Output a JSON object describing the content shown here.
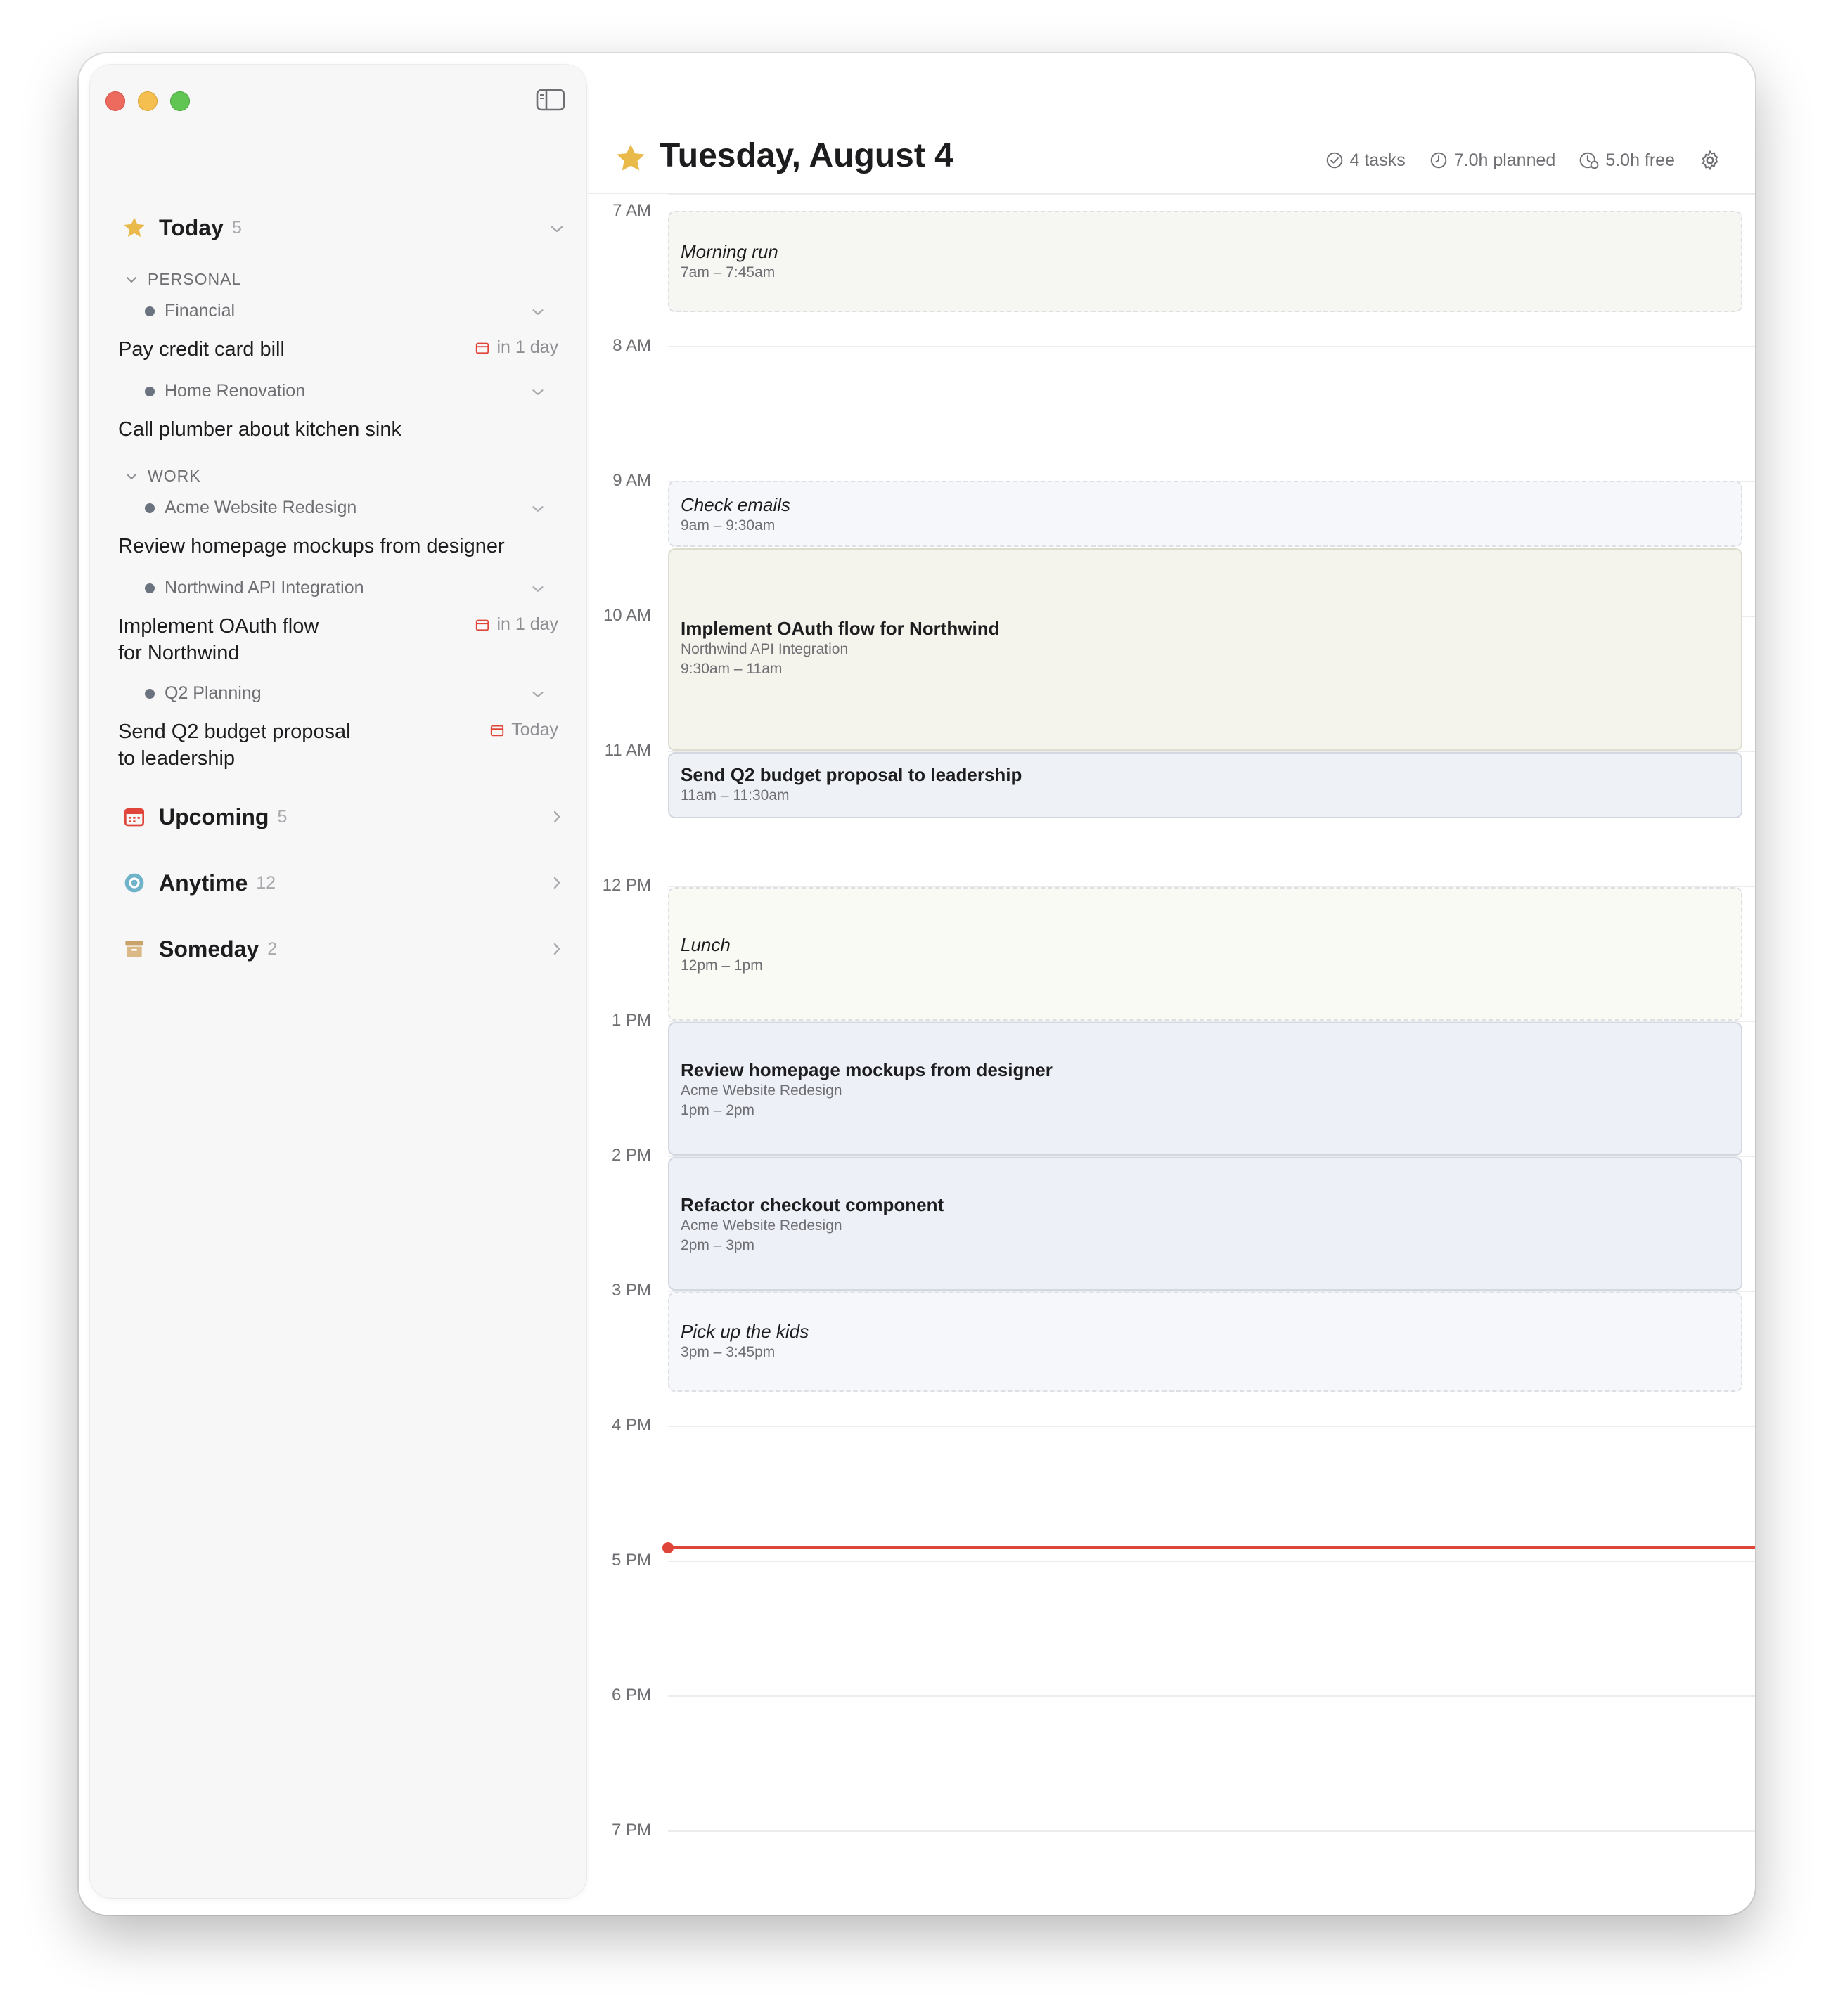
{
  "sidebar": {
    "today": {
      "label": "Today",
      "count": "5"
    },
    "groups": [
      {
        "label": "PERSONAL"
      },
      {
        "label": "WORK"
      }
    ],
    "projects": [
      {
        "label": "Financial"
      },
      {
        "label": "Home Renovation"
      },
      {
        "label": "Acme Website Redesign"
      },
      {
        "label": "Northwind API Integration"
      },
      {
        "label": "Q2 Planning"
      }
    ],
    "tasks": [
      {
        "line1": "Pay credit card bill",
        "line2": "",
        "due": "in 1 day"
      },
      {
        "line1": "Call plumber about kitchen sink",
        "line2": "",
        "due": ""
      },
      {
        "line1": "Review homepage mockups from designer",
        "line2": "",
        "due": ""
      },
      {
        "line1": "Implement OAuth flow",
        "line2": "for Northwind",
        "due": "in 1 day"
      },
      {
        "line1": "Send Q2 budget proposal",
        "line2": "to leadership",
        "due": "Today"
      }
    ],
    "upcoming": {
      "label": "Upcoming",
      "count": "5"
    },
    "anytime": {
      "label": "Anytime",
      "count": "12"
    },
    "someday": {
      "label": "Someday",
      "count": "2"
    }
  },
  "header": {
    "title": "Tuesday, August 4",
    "tasks": "4 tasks",
    "planned": "7.0h planned",
    "free": "5.0h free"
  },
  "timeline": {
    "hours": [
      "7 AM",
      "8 AM",
      "9 AM",
      "10 AM",
      "11 AM",
      "12 PM",
      "1 PM",
      "2 PM",
      "3 PM",
      "4 PM",
      "5 PM",
      "6 PM",
      "7 PM"
    ],
    "events": [
      {
        "title": "Morning run",
        "project": "",
        "time": "7am – 7:45am"
      },
      {
        "title": "Check emails",
        "project": "",
        "time": "9am – 9:30am"
      },
      {
        "title": "Implement OAuth flow for Northwind",
        "project": "Northwind API Integration",
        "time": "9:30am – 11am"
      },
      {
        "title": "Send Q2 budget proposal to leadership",
        "project": "",
        "time": "11am – 11:30am"
      },
      {
        "title": "Lunch",
        "project": "",
        "time": "12pm – 1pm"
      },
      {
        "title": "Review homepage mockups from designer",
        "project": "Acme Website Redesign",
        "time": "1pm – 2pm"
      },
      {
        "title": "Refactor checkout component",
        "project": "Acme Website Redesign",
        "time": "2pm – 3pm"
      },
      {
        "title": "Pick up the kids",
        "project": "",
        "time": "3pm – 3:45pm"
      }
    ]
  },
  "colors": {
    "today_star": "#e9b949",
    "now_line": "#e0453a",
    "event_green": "#f6f7f3",
    "event_blue": "#f5f7fa",
    "event_olive": "#f4f4ec",
    "event_steel": "#eef2f6",
    "event_cream": "#fafaf5",
    "event_lavender": "#edf0f7"
  }
}
